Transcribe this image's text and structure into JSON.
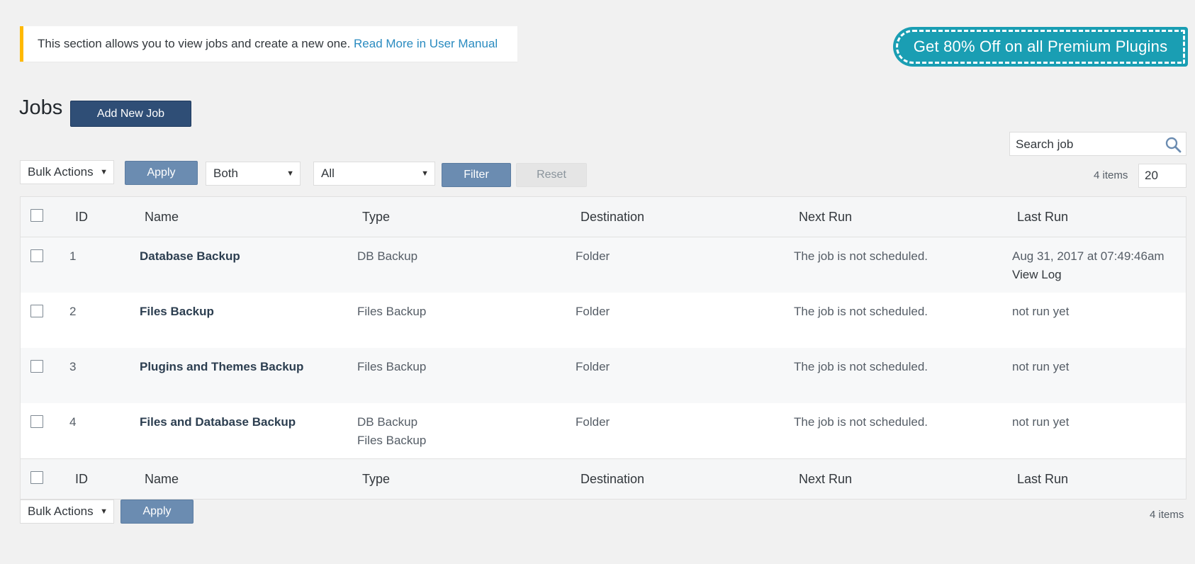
{
  "notice": {
    "text": "This section allows you to view jobs and create a new one.",
    "link": "Read More in User Manual"
  },
  "promo": {
    "text": "Get 80% Off  on all Premium Plugins"
  },
  "page": {
    "title": "Jobs",
    "add_new_label": "Add New Job"
  },
  "search": {
    "placeholder": "Search job"
  },
  "toolbar_top": {
    "bulk_actions": "Bulk Actions",
    "apply_label": "Apply",
    "type_filter": "Both",
    "destination_filter": "All",
    "filter_label": "Filter",
    "reset_label": "Reset",
    "items_count": "4 items",
    "per_page": "20"
  },
  "table": {
    "columns": [
      "ID",
      "Name",
      "Type",
      "Destination",
      "Next Run",
      "Last Run"
    ],
    "rows": [
      {
        "id": "1",
        "name": "Database Backup",
        "type": [
          "DB Backup"
        ],
        "destination": "Folder",
        "next_run": "The job is not scheduled.",
        "last_run": "Aug 31, 2017 at 07:49:46am",
        "last_run_link": "View Log"
      },
      {
        "id": "2",
        "name": "Files Backup",
        "type": [
          "Files Backup"
        ],
        "destination": "Folder",
        "next_run": "The job is not scheduled.",
        "last_run": "not run yet"
      },
      {
        "id": "3",
        "name": "Plugins and Themes Backup",
        "type": [
          "Files Backup"
        ],
        "destination": "Folder",
        "next_run": "The job is not scheduled.",
        "last_run": "not run yet"
      },
      {
        "id": "4",
        "name": "Files and Database Backup",
        "type": [
          "DB Backup",
          "Files Backup"
        ],
        "destination": "Folder",
        "next_run": "The job is not scheduled.",
        "last_run": "not run yet"
      }
    ]
  },
  "toolbar_bottom": {
    "bulk_actions": "Bulk Actions",
    "apply_label": "Apply",
    "items_count": "4 items"
  },
  "colors": {
    "notice_border": "#ffb900",
    "link": "#2a8bc0",
    "promo_bg": "#1a9eb3",
    "primary_button": "#2f4e76",
    "secondary_button": "#6b8cb1"
  },
  "icons": {
    "search": "search-icon",
    "caret": "caret-down-icon"
  }
}
